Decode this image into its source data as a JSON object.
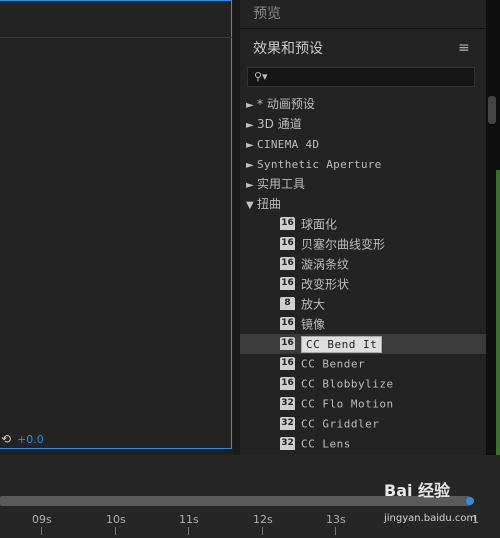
{
  "comp": {
    "footer_icon": "sync-icon",
    "footer_value": "+0.0"
  },
  "fx": {
    "preview_title": "预览",
    "panel_title": "效果和预设",
    "menu_icon": "≡",
    "search_icon": "⚲▾",
    "categories": [
      {
        "arrow": "►",
        "label": "* 动画预设"
      },
      {
        "arrow": "►",
        "label": "3D 通道"
      },
      {
        "arrow": "►",
        "label": "CINEMA 4D"
      },
      {
        "arrow": "►",
        "label": "Synthetic Aperture"
      },
      {
        "arrow": "►",
        "label": "实用工具"
      },
      {
        "arrow": "▼",
        "label": "扭曲"
      }
    ],
    "items": [
      {
        "bits": "16",
        "label": "球面化"
      },
      {
        "bits": "16",
        "label": "贝塞尔曲线变形"
      },
      {
        "bits": "16",
        "label": "漩涡条纹"
      },
      {
        "bits": "16",
        "label": "改变形状"
      },
      {
        "bits": "8",
        "label": "放大"
      },
      {
        "bits": "16",
        "label": "镜像"
      },
      {
        "bits": "16",
        "label": "CC Bend It"
      },
      {
        "bits": "16",
        "label": "CC Bender"
      },
      {
        "bits": "16",
        "label": "CC Blobbylize"
      },
      {
        "bits": "32",
        "label": "CC Flo Motion"
      },
      {
        "bits": "32",
        "label": "CC Griddler"
      },
      {
        "bits": "32",
        "label": "CC Lens"
      }
    ]
  },
  "timeline": {
    "ticks": [
      "09s",
      "10s",
      "11s",
      "12s",
      "13s",
      "1"
    ]
  },
  "watermark": {
    "brand": "Bai 经验",
    "url": "jingyan.baidu.com"
  },
  "colors": {
    "accent": "#2d8ceb",
    "selection": "#dedede"
  }
}
